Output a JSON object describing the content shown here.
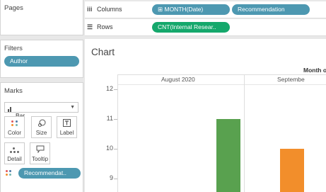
{
  "left_panel": {
    "pages": {
      "title": "Pages"
    },
    "filters": {
      "title": "Filters",
      "pill": "Author"
    },
    "marks": {
      "title": "Marks",
      "mark_type": "Bar",
      "buttons": [
        {
          "label": "Color",
          "icon": "color-dots-icon"
        },
        {
          "label": "Size",
          "icon": "size-icon"
        },
        {
          "label": "Label",
          "icon": "label-icon"
        },
        {
          "label": "Detail",
          "icon": "detail-icon"
        },
        {
          "label": "Tooltip",
          "icon": "tooltip-icon"
        }
      ],
      "color_pill": "Recommendat.."
    }
  },
  "shelves": {
    "columns": {
      "label": "Columns",
      "pills": [
        "MONTH(Date)",
        "Recommendation"
      ]
    },
    "rows": {
      "label": "Rows",
      "pills": [
        "CNT(Internal Resear.."
      ]
    }
  },
  "sheet": {
    "title": "Chart"
  },
  "colors": {
    "dimension_pill": "#4d98b1",
    "measure_pill": "#15a86c",
    "bar_green": "#59a14f",
    "bar_orange": "#f28e2b"
  },
  "chart_data": {
    "type": "bar",
    "column_header": "Month o",
    "categories": [
      "August 2020",
      "Septembe"
    ],
    "y_ticks": [
      9,
      10,
      11,
      12
    ],
    "ylim": [
      8.5,
      12.3
    ],
    "series": [
      {
        "values": [
          11,
          10
        ]
      }
    ],
    "bar_colors": [
      "#59a14f",
      "#f28e2b"
    ]
  }
}
